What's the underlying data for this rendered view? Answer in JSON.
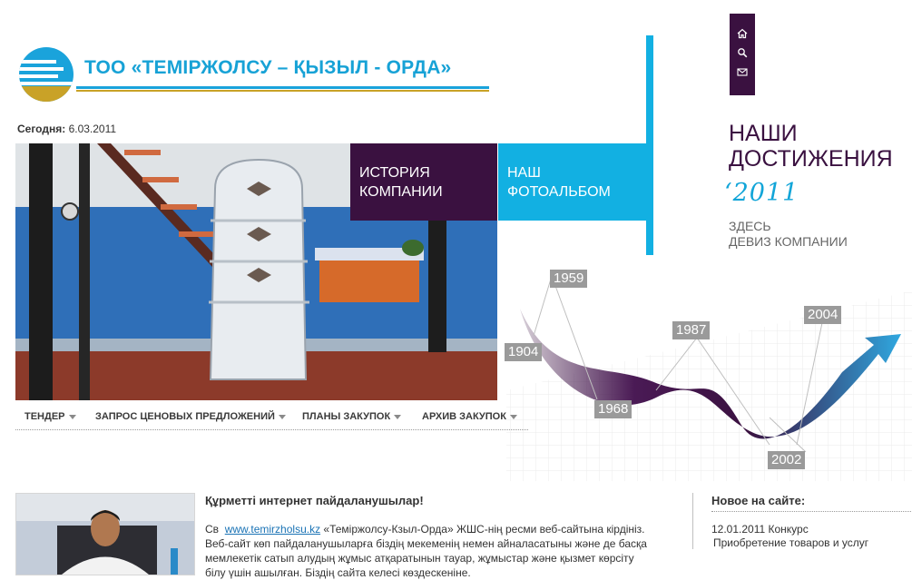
{
  "toolbar": {
    "icons": [
      "home-icon",
      "search-icon",
      "mail-icon"
    ]
  },
  "header": {
    "company_name": "ТОО «ТЕМІРЖОЛСУ – ҚЫЗЫЛ - ОРДА»",
    "today_label": "Сегодня:",
    "today_value": "6.03.2011"
  },
  "tiles": {
    "history": [
      "ИСТОРИЯ",
      "КОМПАНИИ"
    ],
    "photo": [
      "НАШ",
      "ФОТОАЛЬБОМ"
    ]
  },
  "achievements": {
    "title": [
      "НАШИ",
      "ДОСТИЖЕНИЯ"
    ],
    "year": "‘2011",
    "motto": [
      "ЗДЕСЬ",
      "ДЕВИЗ КОМПАНИИ"
    ]
  },
  "timeline": {
    "years": [
      "1959",
      "1904",
      "1968",
      "1987",
      "2004",
      "2002"
    ]
  },
  "nav": {
    "items": [
      {
        "label": "ТЕНДЕР"
      },
      {
        "label": "ЗАПРОС ЦЕНОВЫХ ПРЕДЛОЖЕНИЙ"
      },
      {
        "label": "ПЛАНЫ ЗАКУПОК"
      },
      {
        "label": "АРХИВ ЗАКУПОК"
      }
    ]
  },
  "welcome": {
    "greeting": "Құрметті интернет пайдаланушылар!",
    "prefix": "Св",
    "link": "www.temirzholsu.kz",
    "line1_rest": " «Теміржолсу-Кзыл-Орда» ЖШС-нің ресми веб-сайтына кірдініз.",
    "line2": "Веб-сайт көп пайдаланушыларға біздің мекеменің немен айналасатыны және де басқа",
    "line3": "мемлекетік сатып алудың жұмыс атқаратынын тауар, жұмыстар және қызмет көрсіту",
    "line4": "білу үшін ашылған. Біздің сайта келесі көздескеніне."
  },
  "news": {
    "title": "Новое на сайте:",
    "item_date_text": "12.01.2011 Конкурс",
    "item_text": "Приобретение товаров и услуг"
  },
  "colors": {
    "plum": "#3a1140",
    "cyan": "#12b0e2",
    "title_blue": "#17a2d6",
    "gold": "#c9a227"
  }
}
